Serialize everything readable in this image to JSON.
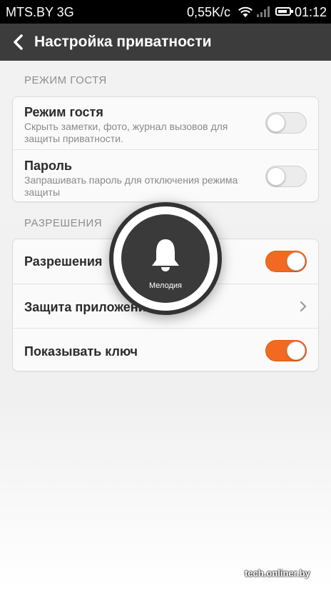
{
  "status_bar": {
    "carrier": "MTS.BY 3G",
    "speed": "0,55K/c",
    "time": "01:12",
    "icons": [
      "wifi-icon",
      "signal-icon",
      "battery-icon"
    ]
  },
  "app_bar": {
    "title": "Настройка приватности",
    "back_icon": "chevron-left-icon"
  },
  "sections": [
    {
      "header": "РЕЖИМ ГОСТЯ",
      "items": [
        {
          "title": "Режим гостя",
          "subtitle": "Скрыть заметки, фото, журнал вызовов для защиты приватности.",
          "toggle": "off"
        },
        {
          "title": "Пароль",
          "subtitle": "Запрашивать пароль для отключения режима защиты",
          "toggle": "off"
        }
      ]
    },
    {
      "header": "РАЗРЕШЕНИЯ",
      "items": [
        {
          "title": "Разрешения",
          "toggle": "on"
        },
        {
          "title": "Защита приложений",
          "control": "chevron-right-icon"
        },
        {
          "title": "Показывать ключ",
          "toggle": "on"
        }
      ]
    }
  ],
  "overlay": {
    "icon": "bell-icon",
    "label": "Мелодия"
  },
  "watermark": "tech.onliner.by",
  "colors": {
    "accent": "#f26a21",
    "app_bar": "#3c3c3c",
    "status_bar": "#000000"
  }
}
